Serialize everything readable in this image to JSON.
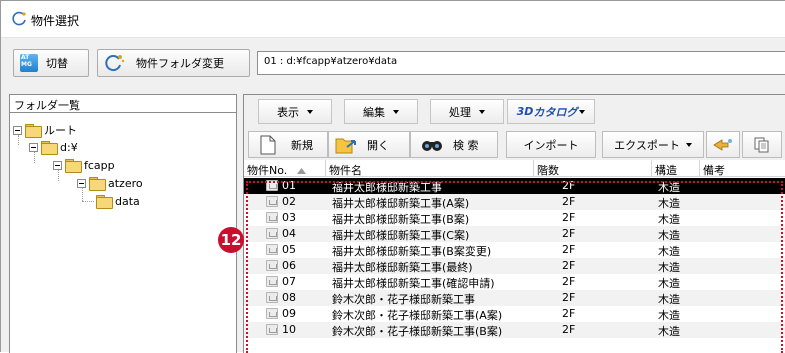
{
  "window": {
    "title": "物件選択"
  },
  "toolbar": {
    "switch_label": "切替",
    "switch_icon_text": "AT\nMG",
    "change_folder_label": "物件フォルダ変更",
    "path_value": "01 : d:¥fcapp¥atzero¥data"
  },
  "tree": {
    "header": "フォルダ一覧",
    "nodes": [
      "ルート",
      "d:¥",
      "fcapp",
      "atzero",
      "data"
    ]
  },
  "menu": {
    "display": "表示",
    "edit": "編集",
    "process": "処理",
    "catalog_3d": "3D",
    "catalog_text": "カタログ"
  },
  "actions": {
    "new": "新規",
    "open": "開く",
    "search": "検 索",
    "import": "インポート",
    "export": "エクスポート"
  },
  "table": {
    "headers": [
      "物件No.",
      "物件名",
      "階数",
      "構造",
      "備考"
    ],
    "rows": [
      {
        "no": "01",
        "name": "福井太郎様邸新築工事",
        "floors": "2F",
        "structure": "木造"
      },
      {
        "no": "02",
        "name": "福井太郎様邸新築工事(A案)",
        "floors": "2F",
        "structure": "木造"
      },
      {
        "no": "03",
        "name": "福井太郎様邸新築工事(B案)",
        "floors": "2F",
        "structure": "木造"
      },
      {
        "no": "04",
        "name": "福井太郎様邸新築工事(C案)",
        "floors": "2F",
        "structure": "木造"
      },
      {
        "no": "05",
        "name": "福井太郎様邸新築工事(B案変更)",
        "floors": "2F",
        "structure": "木造"
      },
      {
        "no": "06",
        "name": "福井太郎様邸新築工事(最終)",
        "floors": "2F",
        "structure": "木造"
      },
      {
        "no": "07",
        "name": "福井太郎様邸新築工事(確認申請)",
        "floors": "2F",
        "structure": "木造"
      },
      {
        "no": "08",
        "name": "鈴木次郎・花子様邸新築工事",
        "floors": "2F",
        "structure": "木造"
      },
      {
        "no": "09",
        "name": "鈴木次郎・花子様邸新築工事(A案)",
        "floors": "2F",
        "structure": "木造"
      },
      {
        "no": "10",
        "name": "鈴木次郎・花子様邸新築工事(B案)",
        "floors": "2F",
        "structure": "木造"
      }
    ],
    "selected_index": 0
  },
  "callout": {
    "number": "12"
  },
  "colors": {
    "accent_red": "#c8102e",
    "selection": "#000000",
    "catalog_blue": "#1f4fb4"
  }
}
